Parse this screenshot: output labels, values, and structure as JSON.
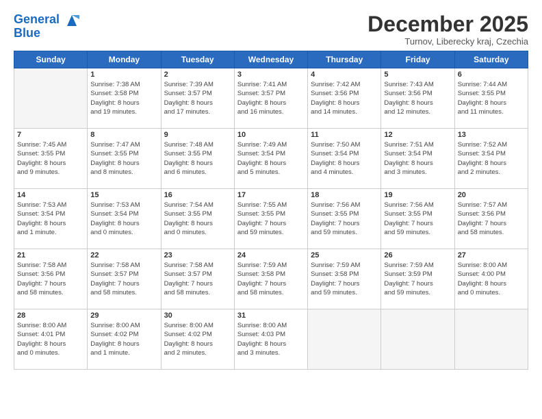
{
  "logo": {
    "line1": "General",
    "line2": "Blue"
  },
  "title": "December 2025",
  "subtitle": "Turnov, Liberecky kraj, Czechia",
  "days_header": [
    "Sunday",
    "Monday",
    "Tuesday",
    "Wednesday",
    "Thursday",
    "Friday",
    "Saturday"
  ],
  "weeks": [
    [
      {
        "num": "",
        "text": ""
      },
      {
        "num": "1",
        "text": "Sunrise: 7:38 AM\nSunset: 3:58 PM\nDaylight: 8 hours\nand 19 minutes."
      },
      {
        "num": "2",
        "text": "Sunrise: 7:39 AM\nSunset: 3:57 PM\nDaylight: 8 hours\nand 17 minutes."
      },
      {
        "num": "3",
        "text": "Sunrise: 7:41 AM\nSunset: 3:57 PM\nDaylight: 8 hours\nand 16 minutes."
      },
      {
        "num": "4",
        "text": "Sunrise: 7:42 AM\nSunset: 3:56 PM\nDaylight: 8 hours\nand 14 minutes."
      },
      {
        "num": "5",
        "text": "Sunrise: 7:43 AM\nSunset: 3:56 PM\nDaylight: 8 hours\nand 12 minutes."
      },
      {
        "num": "6",
        "text": "Sunrise: 7:44 AM\nSunset: 3:55 PM\nDaylight: 8 hours\nand 11 minutes."
      }
    ],
    [
      {
        "num": "7",
        "text": "Sunrise: 7:45 AM\nSunset: 3:55 PM\nDaylight: 8 hours\nand 9 minutes."
      },
      {
        "num": "8",
        "text": "Sunrise: 7:47 AM\nSunset: 3:55 PM\nDaylight: 8 hours\nand 8 minutes."
      },
      {
        "num": "9",
        "text": "Sunrise: 7:48 AM\nSunset: 3:55 PM\nDaylight: 8 hours\nand 6 minutes."
      },
      {
        "num": "10",
        "text": "Sunrise: 7:49 AM\nSunset: 3:54 PM\nDaylight: 8 hours\nand 5 minutes."
      },
      {
        "num": "11",
        "text": "Sunrise: 7:50 AM\nSunset: 3:54 PM\nDaylight: 8 hours\nand 4 minutes."
      },
      {
        "num": "12",
        "text": "Sunrise: 7:51 AM\nSunset: 3:54 PM\nDaylight: 8 hours\nand 3 minutes."
      },
      {
        "num": "13",
        "text": "Sunrise: 7:52 AM\nSunset: 3:54 PM\nDaylight: 8 hours\nand 2 minutes."
      }
    ],
    [
      {
        "num": "14",
        "text": "Sunrise: 7:53 AM\nSunset: 3:54 PM\nDaylight: 8 hours\nand 1 minute."
      },
      {
        "num": "15",
        "text": "Sunrise: 7:53 AM\nSunset: 3:54 PM\nDaylight: 8 hours\nand 0 minutes."
      },
      {
        "num": "16",
        "text": "Sunrise: 7:54 AM\nSunset: 3:55 PM\nDaylight: 8 hours\nand 0 minutes."
      },
      {
        "num": "17",
        "text": "Sunrise: 7:55 AM\nSunset: 3:55 PM\nDaylight: 7 hours\nand 59 minutes."
      },
      {
        "num": "18",
        "text": "Sunrise: 7:56 AM\nSunset: 3:55 PM\nDaylight: 7 hours\nand 59 minutes."
      },
      {
        "num": "19",
        "text": "Sunrise: 7:56 AM\nSunset: 3:55 PM\nDaylight: 7 hours\nand 59 minutes."
      },
      {
        "num": "20",
        "text": "Sunrise: 7:57 AM\nSunset: 3:56 PM\nDaylight: 7 hours\nand 58 minutes."
      }
    ],
    [
      {
        "num": "21",
        "text": "Sunrise: 7:58 AM\nSunset: 3:56 PM\nDaylight: 7 hours\nand 58 minutes."
      },
      {
        "num": "22",
        "text": "Sunrise: 7:58 AM\nSunset: 3:57 PM\nDaylight: 7 hours\nand 58 minutes."
      },
      {
        "num": "23",
        "text": "Sunrise: 7:58 AM\nSunset: 3:57 PM\nDaylight: 7 hours\nand 58 minutes."
      },
      {
        "num": "24",
        "text": "Sunrise: 7:59 AM\nSunset: 3:58 PM\nDaylight: 7 hours\nand 58 minutes."
      },
      {
        "num": "25",
        "text": "Sunrise: 7:59 AM\nSunset: 3:58 PM\nDaylight: 7 hours\nand 59 minutes."
      },
      {
        "num": "26",
        "text": "Sunrise: 7:59 AM\nSunset: 3:59 PM\nDaylight: 7 hours\nand 59 minutes."
      },
      {
        "num": "27",
        "text": "Sunrise: 8:00 AM\nSunset: 4:00 PM\nDaylight: 8 hours\nand 0 minutes."
      }
    ],
    [
      {
        "num": "28",
        "text": "Sunrise: 8:00 AM\nSunset: 4:01 PM\nDaylight: 8 hours\nand 0 minutes."
      },
      {
        "num": "29",
        "text": "Sunrise: 8:00 AM\nSunset: 4:02 PM\nDaylight: 8 hours\nand 1 minute."
      },
      {
        "num": "30",
        "text": "Sunrise: 8:00 AM\nSunset: 4:02 PM\nDaylight: 8 hours\nand 2 minutes."
      },
      {
        "num": "31",
        "text": "Sunrise: 8:00 AM\nSunset: 4:03 PM\nDaylight: 8 hours\nand 3 minutes."
      },
      {
        "num": "",
        "text": ""
      },
      {
        "num": "",
        "text": ""
      },
      {
        "num": "",
        "text": ""
      }
    ]
  ]
}
